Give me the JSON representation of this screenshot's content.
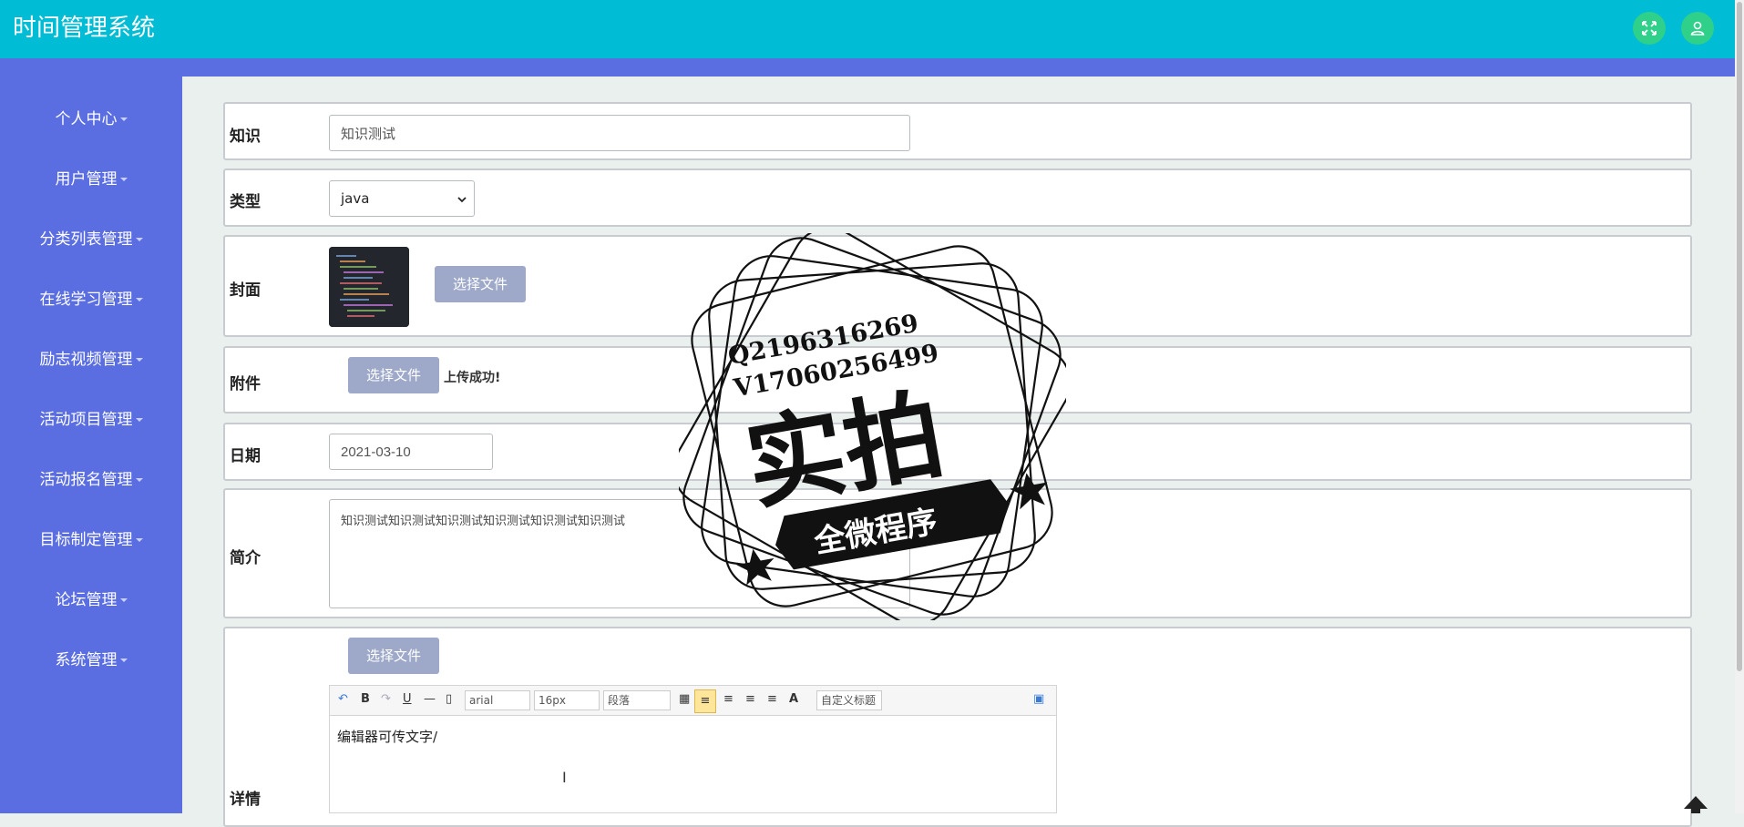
{
  "app": {
    "title": "时间管理系统"
  },
  "header": {
    "fullscreen_icon": "expand-icon",
    "user_icon": "user-icon"
  },
  "sidebar": {
    "items": [
      {
        "label": "个人中心"
      },
      {
        "label": "用户管理"
      },
      {
        "label": "分类列表管理"
      },
      {
        "label": "在线学习管理"
      },
      {
        "label": "励志视频管理"
      },
      {
        "label": "活动项目管理"
      },
      {
        "label": "活动报名管理"
      },
      {
        "label": "目标制定管理"
      },
      {
        "label": "论坛管理"
      },
      {
        "label": "系统管理"
      }
    ]
  },
  "form": {
    "knowledge": {
      "label": "知识",
      "value": "知识测试"
    },
    "type": {
      "label": "类型",
      "selected": "java"
    },
    "cover": {
      "label": "封面",
      "button": "选择文件"
    },
    "attachment": {
      "label": "附件",
      "button": "选择文件",
      "status": "上传成功!"
    },
    "date": {
      "label": "日期",
      "value": "2021-03-10"
    },
    "intro": {
      "label": "简介",
      "value": "知识测试知识测试知识测试知识测试知识测试知识测试"
    },
    "details": {
      "label": "详情",
      "button": "选择文件",
      "content": "编辑器可传文字/"
    }
  },
  "editor": {
    "font": "arial",
    "size": "16px",
    "paragraph": "段落",
    "custom_title": "自定义标题"
  },
  "watermark": {
    "contact_q": "Q2196316269",
    "contact_v": "V17060256499",
    "main_text": "实拍",
    "banner_text": "全微程序"
  }
}
